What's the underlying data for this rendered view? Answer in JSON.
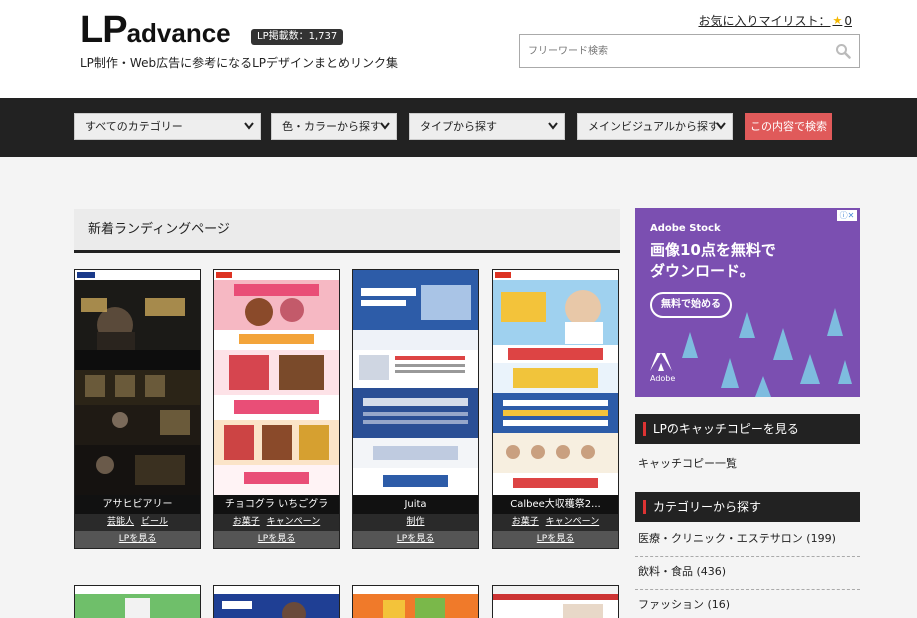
{
  "header": {
    "logo_big": "LP",
    "logo_small": "advance",
    "lp_count": "LP掲載数：1,737",
    "tagline": "LP制作・Web広告に参考になるLPデザインまとめリンク集",
    "favorites_label": "お気に入りマイリスト：",
    "favorites_count": "0",
    "search_placeholder": "フリーワード検索"
  },
  "filters": {
    "category": "すべてのカテゴリー",
    "color": "色・カラーから探す",
    "type": "タイプから探す",
    "visual": "メインビジュアルから探す",
    "submit": "この内容で検索"
  },
  "main": {
    "title": "新着ランディングページ",
    "cards": [
      {
        "title": "アサヒビアリー",
        "tags": [
          "芸能人",
          "ビール"
        ],
        "see": "LPを見る"
      },
      {
        "title": "チョコグラ いちごグラ",
        "tags": [
          "お菓子",
          "キャンペーン"
        ],
        "see": "LPを見る"
      },
      {
        "title": "Juita",
        "tags": [
          "制作"
        ],
        "see": "LPを見る"
      },
      {
        "title": "Calbee大収穫祭2...",
        "tags": [
          "お菓子",
          "キャンペーン"
        ],
        "see": "LPを見る"
      }
    ]
  },
  "ad": {
    "brand": "Adobe Stock",
    "headline_1": "画像10点を無料で",
    "headline_2": "ダウンロード。",
    "cta": "無料で始める",
    "label": "Adobe",
    "info": "ⓘ✕"
  },
  "sidebar": {
    "catchcopy_heading": "LPのキャッチコピーを見る",
    "catchcopy_link": "キャッチコピー一覧",
    "category_heading": "カテゴリーから探す",
    "categories": [
      "医療・クリニック・エステサロン (199)",
      "飲料・食品 (436)",
      "ファッション (16)"
    ]
  },
  "colors": {
    "nav_bg": "#222222",
    "accent_button": "#e05a5a",
    "ad_bg": "#7b4fb1",
    "section_marker": "#dd3333"
  }
}
